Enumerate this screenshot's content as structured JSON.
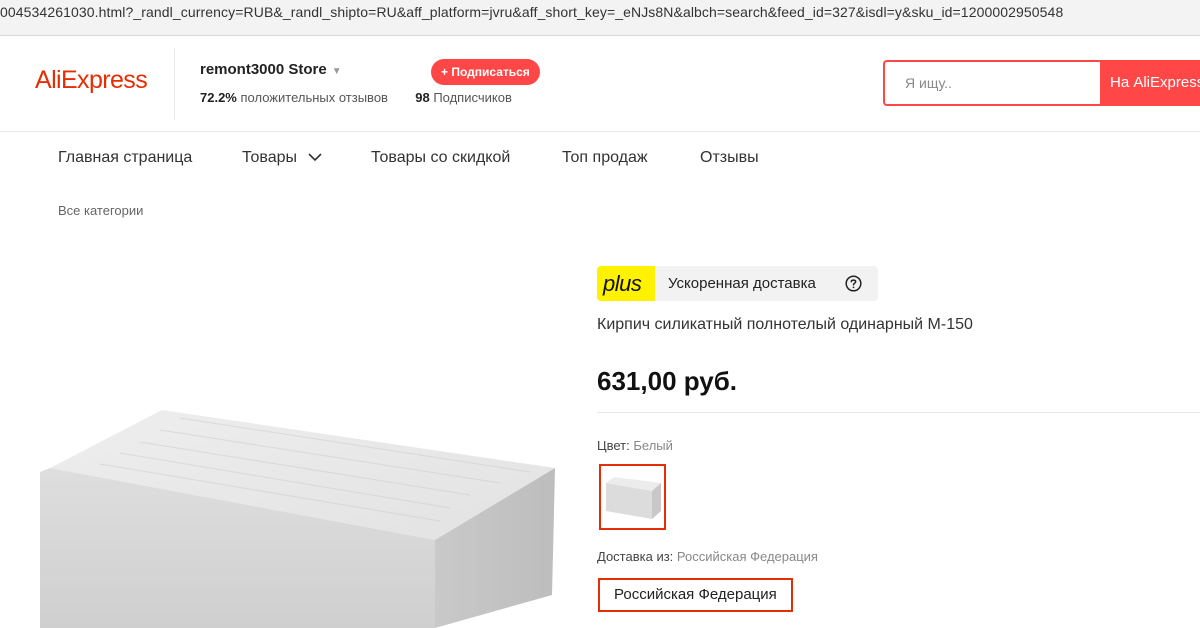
{
  "url_text": "004534261030.html?_randl_currency=RUB&_randl_shipto=RU&aff_platform=jvru&aff_short_key=_eNJs8N&albch=search&feed_id=327&isdl=y&sku_id=1200002950548",
  "header": {
    "logo": "AliExpress",
    "store": {
      "name": "remont3000 Store",
      "caret": "▼",
      "positive_pct": "72.2%",
      "positive_label": "положительных отзывов",
      "subscribers_count": "98",
      "subscribers_label": "Подписчиков",
      "subscribe_label": "+ Подписаться"
    },
    "search": {
      "placeholder": "Я ищу..",
      "button_label": "На AliExpress"
    }
  },
  "nav": {
    "items": [
      "Главная страница",
      "Товары",
      "Товары со скидкой",
      "Топ продаж",
      "Отзывы"
    ]
  },
  "breadcrumb": "Все категории",
  "product": {
    "delivery_badge_brand": "plus",
    "delivery_badge_text": "Ускоренная доставка",
    "title": "Кирпич силикатный полнотелый одинарный М-150",
    "price": "631,00 руб.",
    "color_label": "Цвет:",
    "color_value": "Белый",
    "ship_from_label": "Доставка из:",
    "ship_from_value": "Российская Федерация",
    "ship_from_option": "Российская Федерация"
  },
  "colors": {
    "brand_red": "#ff4747",
    "logo_red": "#e62e04",
    "plus_yellow": "#fff200"
  }
}
